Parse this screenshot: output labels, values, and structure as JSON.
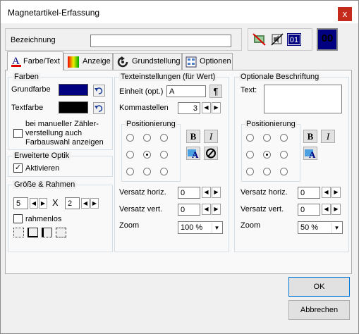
{
  "window": {
    "title": "Magnetartikel-Erfassung",
    "close": "x"
  },
  "header": {
    "bezeichnung_label": "Bezeichnung",
    "bezeichnung_value": "",
    "counter_display": "01",
    "preview_display": "00"
  },
  "tabs": [
    {
      "label": "Farbe/Text",
      "icon": "font-color-icon"
    },
    {
      "label": "Anzeige",
      "icon": "gradient-icon"
    },
    {
      "label": "Grundstellung",
      "icon": "reset-arrow-icon"
    },
    {
      "label": "Optionen",
      "icon": "options-grid-icon"
    }
  ],
  "farben": {
    "legend": "Farben",
    "grundfarbe_label": "Grundfarbe",
    "grundfarbe_color": "#000080",
    "textfarbe_label": "Textfarbe",
    "textfarbe_color": "#000000",
    "manual_line1": "bei manueller Zähler-",
    "manual_line2": "verstellung auch",
    "manual_line3": "Farbauswahl anzeigen",
    "manual_checked": false
  },
  "optik": {
    "legend": "Erweiterte Optik",
    "aktivieren_label": "Aktivieren",
    "aktivieren_checked": true
  },
  "groesse": {
    "legend": "Größe & Rahmen",
    "width": "5",
    "times": "X",
    "height": "2",
    "rahmenlos_label": "rahmenlos",
    "rahmenlos_checked": false
  },
  "text_settings": {
    "legend": "Texteinstellungen (für Wert)",
    "einheit_label": "Einheit (opt.)",
    "einheit_value": "A",
    "pilcrow": "¶",
    "kommastellen_label": "Kommastellen",
    "kommastellen_value": "3",
    "positionierung_legend": "Positionierung",
    "bold": "B",
    "italic": "I",
    "versatz_h_label": "Versatz horiz.",
    "versatz_h_value": "0",
    "versatz_v_label": "Versatz vert.",
    "versatz_v_value": "0",
    "zoom_label": "Zoom",
    "zoom_value": "100 %"
  },
  "optional_label": {
    "legend": "Optionale Beschriftung",
    "text_label": "Text:",
    "text_value": "",
    "positionierung_legend": "Positionierung",
    "bold": "B",
    "italic": "I",
    "versatz_h_label": "Versatz horiz.",
    "versatz_h_value": "0",
    "versatz_v_label": "Versatz vert.",
    "versatz_v_value": "0",
    "zoom_label": "Zoom",
    "zoom_value": "50 %"
  },
  "buttons": {
    "ok": "OK",
    "abbrechen": "Abbrechen"
  }
}
